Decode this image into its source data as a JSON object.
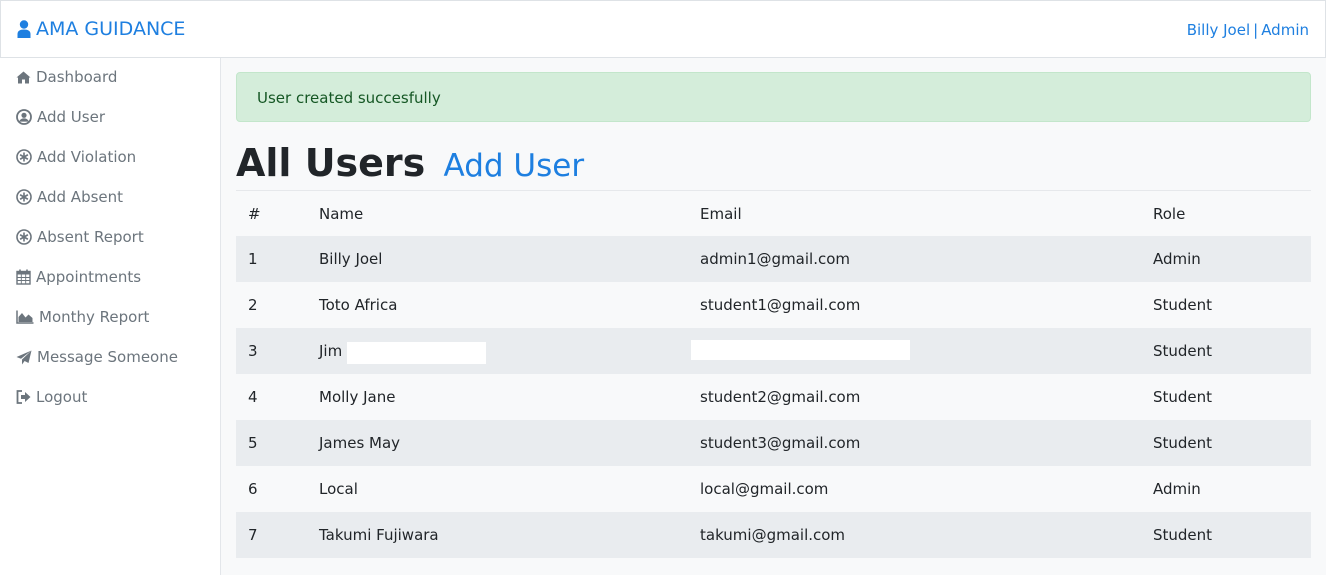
{
  "brand": {
    "title": "AMA GUIDANCE",
    "icon": "user-icon"
  },
  "header": {
    "user_name": "Billy Joel",
    "separator": "|",
    "role": "Admin"
  },
  "sidebar": {
    "items": [
      {
        "label": "Dashboard",
        "icon": "home-icon"
      },
      {
        "label": "Add User",
        "icon": "user-circle-icon"
      },
      {
        "label": "Add Violation",
        "icon": "asterisk-icon"
      },
      {
        "label": "Add Absent",
        "icon": "asterisk-icon"
      },
      {
        "label": "Absent Report",
        "icon": "asterisk-icon"
      },
      {
        "label": "Appointments",
        "icon": "calendar-icon"
      },
      {
        "label": "Monthy Report",
        "icon": "area-chart-icon"
      },
      {
        "label": "Message Someone",
        "icon": "paper-plane-icon"
      },
      {
        "label": "Logout",
        "icon": "sign-out-icon"
      }
    ]
  },
  "alert": {
    "message": "User created succesfully",
    "color": "#d4edda"
  },
  "page": {
    "title": "All Users",
    "add_link": "Add User"
  },
  "table": {
    "headers": [
      "#",
      "Name",
      "Email",
      "Role"
    ],
    "rows": [
      {
        "id": "1",
        "name": "Billy Joel",
        "email": "admin1@gmail.com",
        "role": "Admin"
      },
      {
        "id": "2",
        "name": "Toto Africa",
        "email": "student1@gmail.com",
        "role": "Student"
      },
      {
        "id": "3",
        "name": "Jim",
        "email": "",
        "role": "Student"
      },
      {
        "id": "4",
        "name": "Molly Jane",
        "email": "student2@gmail.com",
        "role": "Student"
      },
      {
        "id": "5",
        "name": "James May",
        "email": "student3@gmail.com",
        "role": "Student"
      },
      {
        "id": "6",
        "name": "Local",
        "email": "local@gmail.com",
        "role": "Admin"
      },
      {
        "id": "7",
        "name": "Takumi Fujiwara",
        "email": "takumi@gmail.com",
        "role": "Student"
      }
    ]
  },
  "colors": {
    "accent": "#1e7fe0",
    "sidebar_text": "#6c757d",
    "alert_text": "#155724"
  }
}
